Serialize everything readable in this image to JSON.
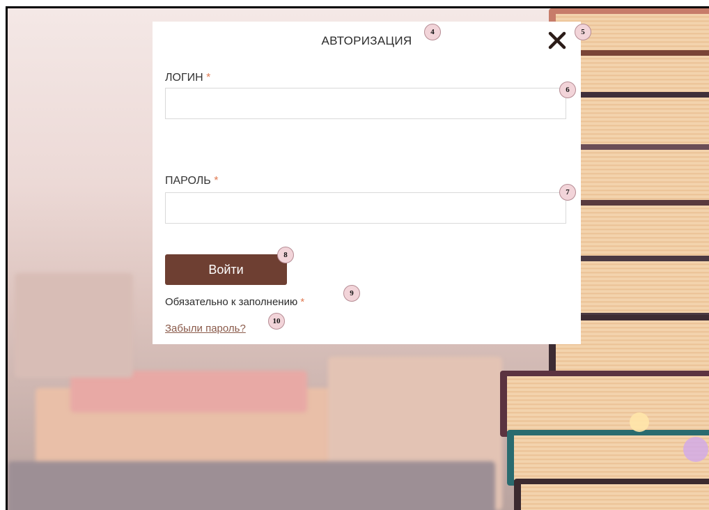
{
  "dialog": {
    "title": "АВТОРИЗАЦИЯ",
    "close_icon": "close-icon"
  },
  "login": {
    "label": "ЛОГИН",
    "required_mark": "*",
    "value": "",
    "placeholder": ""
  },
  "password": {
    "label": "ПАРОЛЬ",
    "required_mark": "*",
    "value": "",
    "placeholder": ""
  },
  "submit": {
    "label": "Войти"
  },
  "required_note": {
    "text": "Обязательно к заполнению",
    "mark": "*"
  },
  "forgot_link": {
    "text": "Забыли пароль?"
  },
  "markers": [
    "4",
    "5",
    "6",
    "7",
    "8",
    "9",
    "10"
  ],
  "colors": {
    "button": "#6e3f32",
    "required": "#e07a52",
    "link": "#8a5a4a",
    "marker": "#f2d4d9"
  }
}
